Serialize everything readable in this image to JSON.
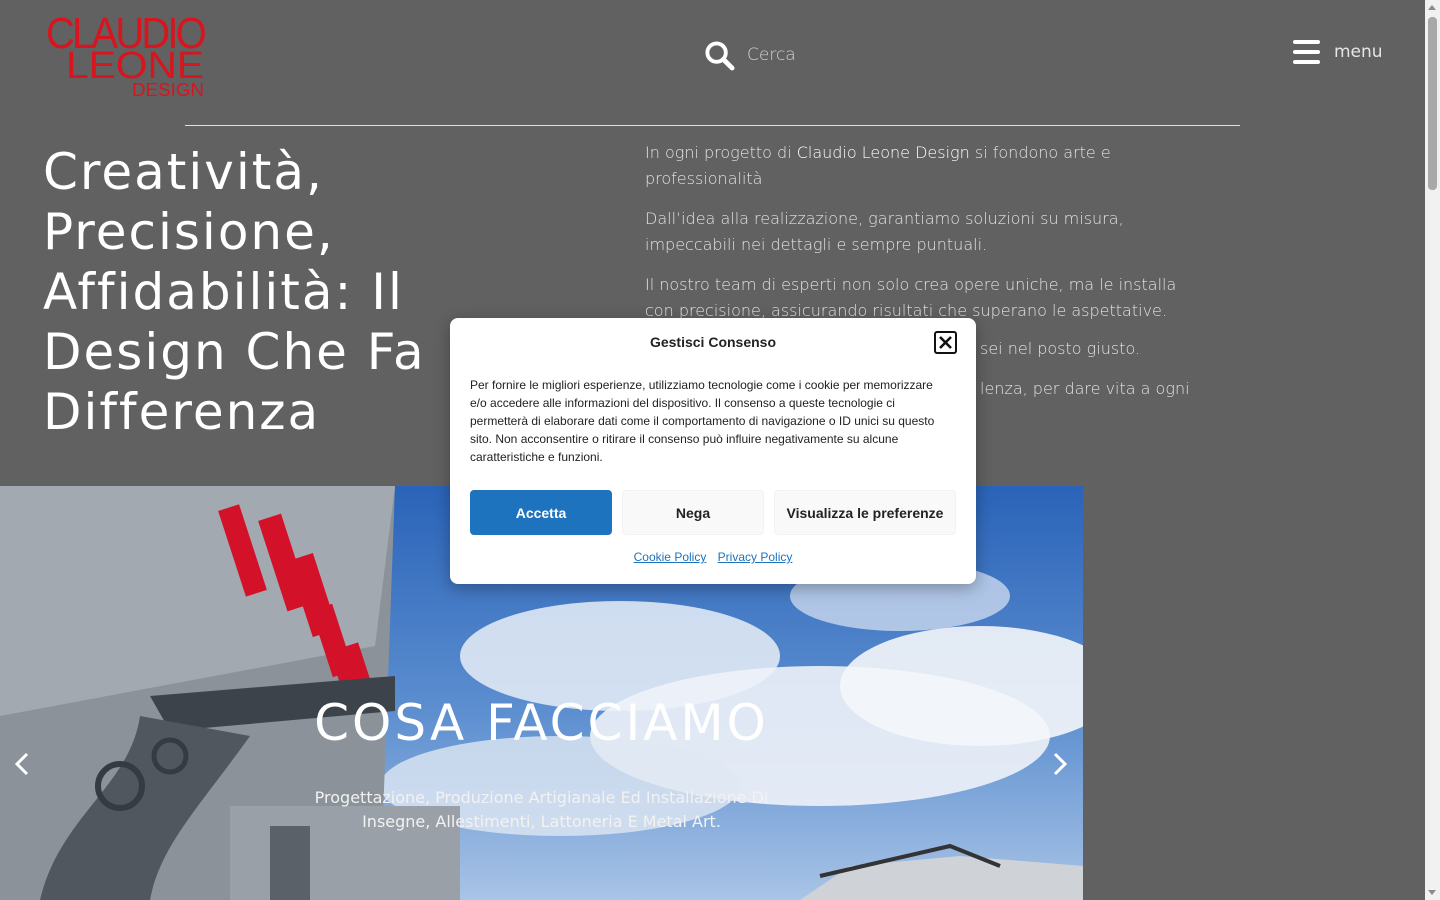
{
  "header": {
    "logo_text_lines": [
      "CLAUDIO",
      "LEONE",
      "DESIGN"
    ],
    "search_label": "Cerca",
    "menu_label": "menu"
  },
  "hero": {
    "title": "Creatività, Precisione, Affidabilità: Il Design Che Fa Differenza",
    "intro": [
      {
        "pre": "In ogni progetto di ",
        "brand": "Claudio Leone Design",
        "post": " si fondono arte e professionalità"
      },
      {
        "text": "Dall’idea alla realizzazione, garantiamo soluzioni su misura, impeccabili nei dettagli e sempre puntuali."
      },
      {
        "text": "Il nostro team di esperti non solo crea opere uniche, ma le installa con precisione, assicurando risultati che superano le aspettative."
      },
      {
        "text": "sei nel posto giusto."
      },
      {
        "text": "lenza, per dare vita a ogni"
      }
    ]
  },
  "slider": {
    "title": "COSA FACCIAMO",
    "subtitle": "Progettazione, Produzione Artigianale Ed Installazione Di Insegne, Allestimenti, Lattoneria E Metal Art."
  },
  "consent": {
    "title": "Gestisci Consenso",
    "text": "Per fornire le migliori esperienze, utilizziamo tecnologie come i cookie per memorizzare e/o accedere alle informazioni del dispositivo. Il consenso a queste tecnologie ci permetterà di elaborare dati come il comportamento di navigazione o ID unici su questo sito. Non acconsentire o ritirare il consenso può influire negativamente su alcune caratteristiche e funzioni.",
    "accept_label": "Accetta",
    "deny_label": "Nega",
    "prefs_label": "Visualizza le preferenze",
    "cookie_policy_label": "Cookie Policy",
    "privacy_policy_label": "Privacy Policy"
  },
  "colors": {
    "background": "#616161",
    "logo_red": "#d8141e",
    "accept_blue": "#1e73be"
  },
  "icons": [
    "search-icon",
    "hamburger-icon",
    "close-icon",
    "chevron-left-icon",
    "chevron-right-icon"
  ]
}
